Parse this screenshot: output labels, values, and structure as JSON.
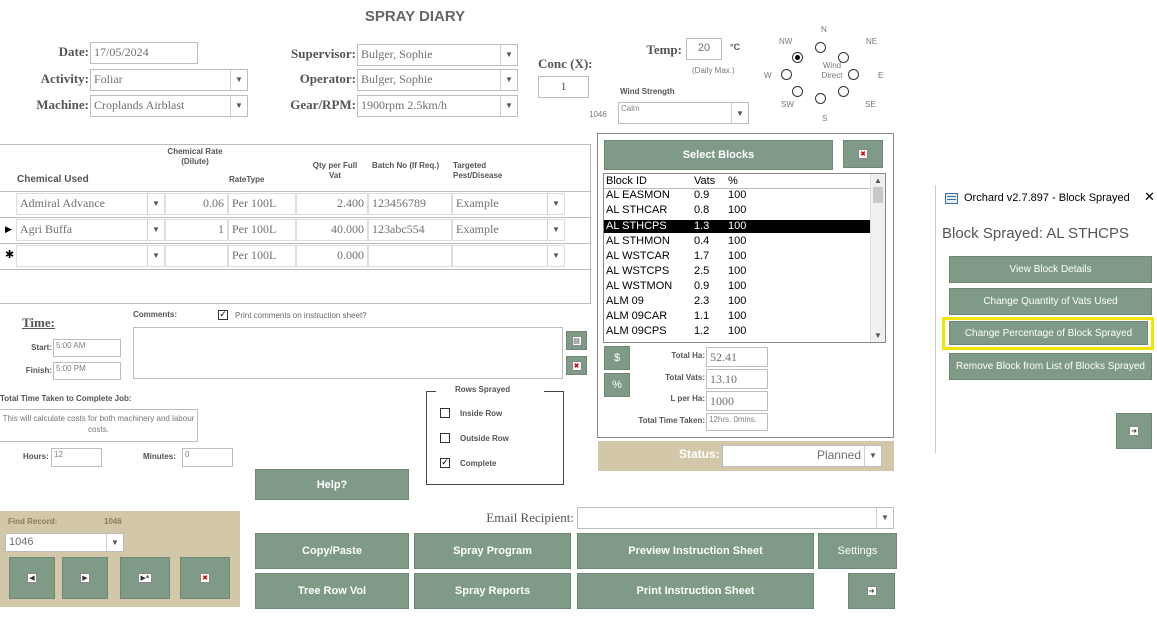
{
  "form": {
    "title": "SPRAY DIARY",
    "date_label": "Date:",
    "date_value": "17/05/2024",
    "activity_label": "Activity:",
    "activity_value": "Foliar",
    "machine_label": "Machine:",
    "machine_value": "Croplands Airblast",
    "supervisor_label": "Supervisor:",
    "supervisor_value": "Bulger, Sophie",
    "operator_label": "Operator:",
    "operator_value": "Bulger, Sophie",
    "gear_label": "Gear/RPM:",
    "gear_value": "1900rpm 2.5km/h",
    "conc_label": "Conc (X):",
    "conc_value": "1",
    "record_number": "1046",
    "temp_label": "Temp:",
    "temp_value": "20",
    "temp_unit": "°C",
    "temp_note": "(Daily Max.)",
    "wind_strength_label": "Wind Strength",
    "wind_strength_value": "Calm",
    "wind_labels": {
      "n": "N",
      "nw": "NW",
      "ne": "NE",
      "w": "W",
      "e": "E",
      "sw": "SW",
      "se": "SE",
      "s": "S",
      "direct": "Wind Direct"
    }
  },
  "chemicals": {
    "headers": {
      "chemical": "Chemical Used",
      "rate": "Chemical Rate (Dilute)",
      "ratetype": "RateType",
      "qty": "Qty per Full Vat",
      "batch": "Batch No (If Req.)",
      "target": "Targeted Pest/Disease"
    },
    "rows": [
      {
        "name": "Admiral Advance",
        "rate": "0.06",
        "ratetype": "Per 100L",
        "qty": "2.400",
        "batch": "123456789",
        "target": "Example"
      },
      {
        "name": "Agri Buffa",
        "rate": "1",
        "ratetype": "Per 100L",
        "qty": "40.000",
        "batch": "123abc554",
        "target": "Example"
      },
      {
        "name": "",
        "rate": "",
        "ratetype": "Per 100L",
        "qty": "0.000",
        "batch": "",
        "target": ""
      }
    ]
  },
  "time": {
    "time_label": "Time:",
    "comments_label": "Comments:",
    "print_comments_label": "Print comments on instruction sheet?",
    "start_label": "Start:",
    "start_value": "5:00 AM",
    "finish_label": "Finish:",
    "finish_value": "5:00 PM",
    "total_label": "Total Time Taken to Complete Job:",
    "costs_note": "This will calculate costs for both machinery and labour costs.",
    "hours_label": "Hours:",
    "hours_value": "12",
    "minutes_label": "Minutes:",
    "minutes_value": "0"
  },
  "rows_sprayed": {
    "label": "Rows Sprayed",
    "inside": "Inside Row",
    "outside": "Outside Row",
    "complete": "Complete"
  },
  "blocks": {
    "select_button": "Select Blocks",
    "headers": {
      "id": "Block ID",
      "vats": "Vats",
      "pct": "%"
    },
    "rows": [
      {
        "id": "AL EASMON",
        "vats": "0.9",
        "pct": "100"
      },
      {
        "id": "AL STHCAR",
        "vats": "0.8",
        "pct": "100"
      },
      {
        "id": "AL STHCPS",
        "vats": "1.3",
        "pct": "100"
      },
      {
        "id": "AL STHMON",
        "vats": "0.4",
        "pct": "100"
      },
      {
        "id": "AL WSTCAR",
        "vats": "1.7",
        "pct": "100"
      },
      {
        "id": "AL WSTCPS",
        "vats": "2.5",
        "pct": "100"
      },
      {
        "id": "AL WSTMON",
        "vats": "0.9",
        "pct": "100"
      },
      {
        "id": "ALM 09",
        "vats": "2.3",
        "pct": "100"
      },
      {
        "id": "ALM 09CAR",
        "vats": "1.1",
        "pct": "100"
      },
      {
        "id": "ALM 09CPS",
        "vats": "1.2",
        "pct": "100"
      }
    ],
    "dollar_btn": "$",
    "pct_btn": "%",
    "total_ha_label": "Total Ha:",
    "total_ha_value": "52.41",
    "total_vats_label": "Total Vats:",
    "total_vats_value": "13.10",
    "l_per_ha_label": "L per Ha:",
    "l_per_ha_value": "1000",
    "total_time_label": "Total Time Taken:",
    "total_time_value": "12hrs. 0mins.",
    "status_label": "Status:",
    "status_value": "Planned"
  },
  "buttons": {
    "help": "Help?",
    "copy_paste": "Copy/Paste",
    "spray_program": "Spray Program",
    "preview": "Preview Instruction Sheet",
    "settings": "Settings",
    "tree_row": "Tree Row Vol",
    "spray_reports": "Spray Reports",
    "print": "Print Instruction Sheet"
  },
  "email": {
    "label": "Email Recipient:",
    "value": ""
  },
  "find": {
    "label": "Find Record:",
    "number": "1046",
    "value": "1046"
  },
  "popup": {
    "title": "Orchard v2.7.897 - Block Sprayed",
    "heading": "Block Sprayed: AL STHCPS",
    "view": "View Block Details",
    "change_qty": "Change Quantity of Vats Used",
    "change_pct": "Change Percentage of Block Sprayed",
    "remove": "Remove Block from List of Blocks Sprayed",
    "highlight_color": "#f2e600"
  }
}
